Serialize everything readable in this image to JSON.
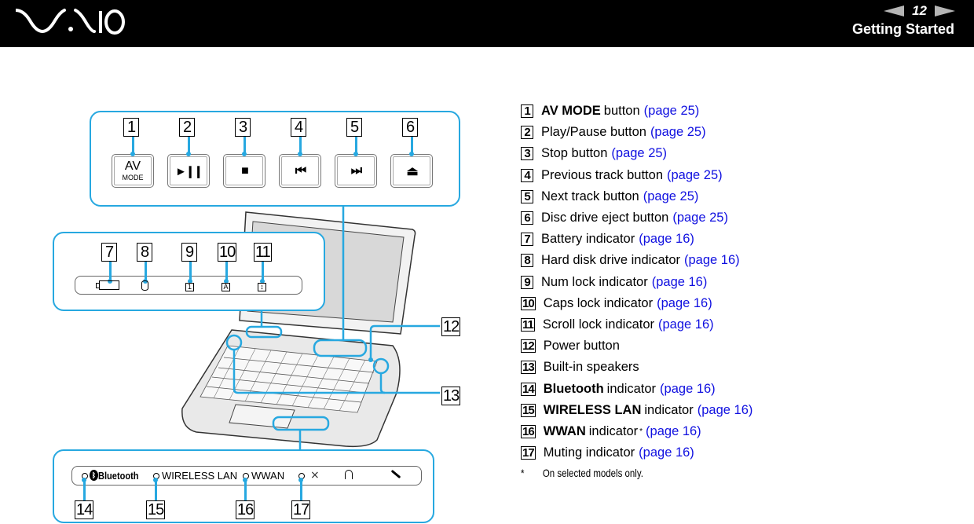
{
  "header": {
    "brand": "VAIO",
    "page_number": "12",
    "section_title": "Getting Started",
    "prev_icon": "prev-page-arrow",
    "next_icon": "next-page-arrow"
  },
  "legend": [
    {
      "n": "1",
      "bold": "AV MODE",
      "text": "button",
      "link": "(page 25)"
    },
    {
      "n": "2",
      "bold": "",
      "text": "Play/Pause button",
      "link": "(page 25)"
    },
    {
      "n": "3",
      "bold": "",
      "text": "Stop button",
      "link": "(page 25)"
    },
    {
      "n": "4",
      "bold": "",
      "text": "Previous track button",
      "link": "(page 25)"
    },
    {
      "n": "5",
      "bold": "",
      "text": "Next track button",
      "link": "(page 25)"
    },
    {
      "n": "6",
      "bold": "",
      "text": "Disc drive eject button",
      "link": "(page 25)"
    },
    {
      "n": "7",
      "bold": "",
      "text": "Battery indicator",
      "link": "(page 16)"
    },
    {
      "n": "8",
      "bold": "",
      "text": "Hard disk drive indicator",
      "link": "(page 16)"
    },
    {
      "n": "9",
      "bold": "",
      "text": "Num lock indicator",
      "link": "(page 16)"
    },
    {
      "n": "10",
      "bold": "",
      "text": "Caps lock indicator",
      "link": "(page 16)"
    },
    {
      "n": "11",
      "bold": "",
      "text": "Scroll lock indicator",
      "link": "(page 16)"
    },
    {
      "n": "12",
      "bold": "",
      "text": "Power button",
      "link": ""
    },
    {
      "n": "13",
      "bold": "",
      "text": "Built-in speakers",
      "link": ""
    },
    {
      "n": "14",
      "bold": "Bluetooth",
      "text": "indicator",
      "link": "(page 16)"
    },
    {
      "n": "15",
      "bold": "WIRELESS LAN",
      "text": "indicator",
      "link": "(page 16)"
    },
    {
      "n": "16",
      "bold": "WWAN",
      "text": "indicator",
      "sup": "*",
      "link": "(page 16)"
    },
    {
      "n": "17",
      "bold": "",
      "text": "Muting indicator",
      "link": "(page 16)"
    }
  ],
  "footnote": {
    "mark": "*",
    "text": "On selected models only."
  },
  "figure": {
    "av_buttons": [
      {
        "n": "1",
        "label_top": "AV",
        "label_bottom": "MODE",
        "icon": "av-mode"
      },
      {
        "n": "2",
        "glyph": "►❙❙",
        "icon": "play-pause-icon"
      },
      {
        "n": "3",
        "glyph": "■",
        "icon": "stop-icon"
      },
      {
        "n": "4",
        "glyph": "⏮",
        "icon": "previous-track-icon"
      },
      {
        "n": "5",
        "glyph": "⏭",
        "icon": "next-track-icon"
      },
      {
        "n": "6",
        "glyph": "⏏",
        "icon": "eject-icon"
      }
    ],
    "indicators_top": [
      {
        "n": "7",
        "icon": "battery-icon"
      },
      {
        "n": "8",
        "icon": "hard-disk-icon"
      },
      {
        "n": "9",
        "icon": "num-lock-icon",
        "glyph": "1"
      },
      {
        "n": "10",
        "icon": "caps-lock-icon",
        "glyph": "A"
      },
      {
        "n": "11",
        "icon": "scroll-lock-icon",
        "glyph": "↕"
      }
    ],
    "indicators_bottom": [
      {
        "n": "14",
        "label": "Bluetooth"
      },
      {
        "n": "15",
        "label": "WIRELESS LAN"
      },
      {
        "n": "16",
        "label": "WWAN"
      },
      {
        "n": "17",
        "label": ""
      }
    ],
    "side_callouts": [
      "12",
      "13"
    ],
    "accent_color": "#27a8e0"
  }
}
